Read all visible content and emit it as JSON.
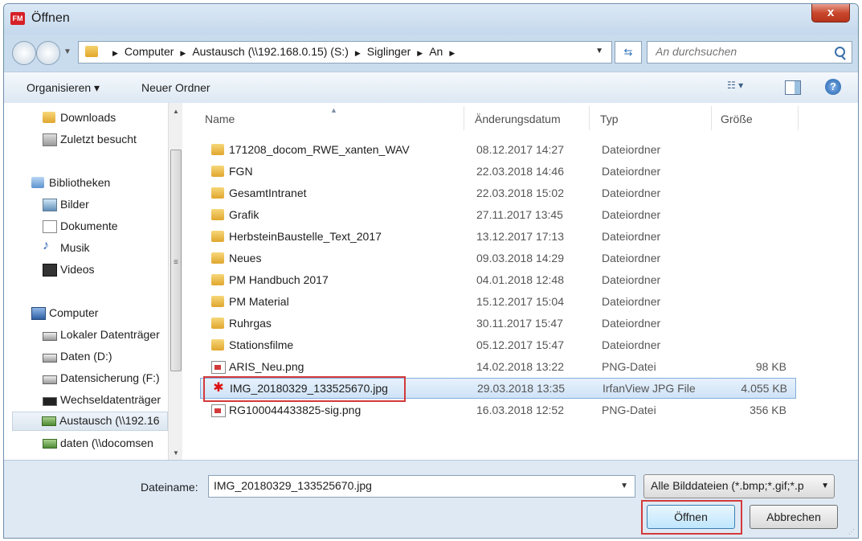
{
  "window": {
    "app_badge": "FM",
    "title": "Öffnen",
    "close_label": "x"
  },
  "address": {
    "crumbs": [
      "Computer",
      "Austausch (\\\\192.168.0.15) (S:)",
      "Siglinger",
      "An"
    ],
    "search_placeholder": "An durchsuchen"
  },
  "toolbar": {
    "organize_label": "Organisieren ▾",
    "new_folder_label": "Neuer Ordner",
    "view_label": "☷ ▾",
    "help_label": "?"
  },
  "sidebar": {
    "items": [
      {
        "label": "Downloads",
        "icon": "downloads-icon"
      },
      {
        "label": "Zuletzt besucht",
        "icon": "recent-places-icon"
      },
      {
        "label": "Bibliotheken",
        "icon": "libraries-icon"
      },
      {
        "label": "Bilder",
        "icon": "pictures-icon"
      },
      {
        "label": "Dokumente",
        "icon": "documents-icon"
      },
      {
        "label": "Musik",
        "icon": "music-icon"
      },
      {
        "label": "Videos",
        "icon": "videos-icon"
      },
      {
        "label": "Computer",
        "icon": "computer-icon"
      },
      {
        "label": "Lokaler Datenträger",
        "icon": "local-disk-icon"
      },
      {
        "label": "Daten (D:)",
        "icon": "drive-icon"
      },
      {
        "label": "Datensicherung (F:)",
        "icon": "drive-icon"
      },
      {
        "label": "Wechseldatenträger",
        "icon": "removable-drive-icon"
      },
      {
        "label": "Austausch (\\\\192.16",
        "icon": "network-drive-icon",
        "selected": true
      },
      {
        "label": "daten (\\\\docomsen",
        "icon": "network-drive-icon"
      }
    ]
  },
  "columns": {
    "name": "Name",
    "date": "Änderungsdatum",
    "type": "Typ",
    "size": "Größe"
  },
  "files": [
    {
      "name": "171208_docom_RWE_xanten_WAV",
      "date": "08.12.2017 14:27",
      "type": "Dateiordner",
      "size": "",
      "kind": "folder"
    },
    {
      "name": "FGN",
      "date": "22.03.2018 14:46",
      "type": "Dateiordner",
      "size": "",
      "kind": "folder"
    },
    {
      "name": "GesamtIntranet",
      "date": "22.03.2018 15:02",
      "type": "Dateiordner",
      "size": "",
      "kind": "folder"
    },
    {
      "name": "Grafik",
      "date": "27.11.2017 13:45",
      "type": "Dateiordner",
      "size": "",
      "kind": "folder"
    },
    {
      "name": "HerbsteinBaustelle_Text_2017",
      "date": "13.12.2017 17:13",
      "type": "Dateiordner",
      "size": "",
      "kind": "folder"
    },
    {
      "name": "Neues",
      "date": "09.03.2018 14:29",
      "type": "Dateiordner",
      "size": "",
      "kind": "folder"
    },
    {
      "name": "PM Handbuch 2017",
      "date": "04.01.2018 12:48",
      "type": "Dateiordner",
      "size": "",
      "kind": "folder"
    },
    {
      "name": "PM Material",
      "date": "15.12.2017 15:04",
      "type": "Dateiordner",
      "size": "",
      "kind": "folder"
    },
    {
      "name": "Ruhrgas",
      "date": "30.11.2017 15:47",
      "type": "Dateiordner",
      "size": "",
      "kind": "folder"
    },
    {
      "name": "Stationsfilme",
      "date": "05.12.2017 15:47",
      "type": "Dateiordner",
      "size": "",
      "kind": "folder"
    },
    {
      "name": "ARIS_Neu.png",
      "date": "14.02.2018 13:22",
      "type": "PNG-Datei",
      "size": "98 KB",
      "kind": "png"
    },
    {
      "name": "IMG_20180329_133525670.jpg",
      "date": "29.03.2018 13:35",
      "type": "IrfanView JPG File",
      "size": "4.055 KB",
      "kind": "jpg",
      "selected": true
    },
    {
      "name": "RG100044433825-sig.png",
      "date": "16.03.2018 12:52",
      "type": "PNG-Datei",
      "size": "356 KB",
      "kind": "png"
    }
  ],
  "footer": {
    "filename_label": "Dateiname:",
    "filename_value": "IMG_20180329_133525670.jpg",
    "filter_label": "Alle Bilddateien (*.bmp;*.gif;*.p",
    "open_label": "Öffnen",
    "cancel_label": "Abbrechen"
  }
}
